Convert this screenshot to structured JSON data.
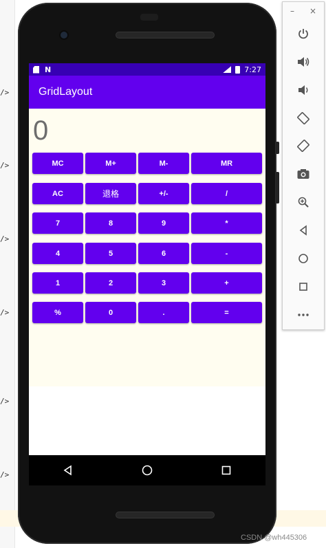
{
  "ide": {
    "markers": [
      "/>",
      "/>",
      "/>",
      "/>",
      "/>",
      "/>",
      "/>"
    ]
  },
  "status_bar": {
    "time": "7:27",
    "left_icons": [
      "sd-card-icon",
      "n-icon"
    ],
    "right_icons": [
      "signal-icon",
      "battery-icon"
    ]
  },
  "app_bar": {
    "title": "GridLayout"
  },
  "display": {
    "value": "0"
  },
  "keypad": {
    "rows": [
      [
        "MC",
        "M+",
        "M-",
        "MR"
      ],
      [
        "AC",
        "退格",
        "+/-",
        "/"
      ],
      [
        "7",
        "8",
        "9",
        "*"
      ],
      [
        "4",
        "5",
        "6",
        "-"
      ],
      [
        "1",
        "2",
        "3",
        "+"
      ],
      [
        "%",
        "0",
        ".",
        "="
      ]
    ]
  },
  "nav_bar": {
    "icons": [
      "back-icon",
      "home-icon",
      "recents-icon"
    ]
  },
  "emulator_toolbar": {
    "window_controls": [
      "–",
      "×"
    ],
    "tools": [
      "power-icon",
      "volume-up-icon",
      "volume-down-icon",
      "rotate-left-icon",
      "rotate-right-icon",
      "camera-icon",
      "zoom-icon",
      "back-icon",
      "home-icon",
      "overview-icon",
      "more-icon"
    ]
  },
  "watermark": "CSDN @wh445306",
  "colors": {
    "status_bar": "#3700b3",
    "app_bar": "#6200ee",
    "button": "#6200ee",
    "display_bg": "#fffdf0"
  }
}
